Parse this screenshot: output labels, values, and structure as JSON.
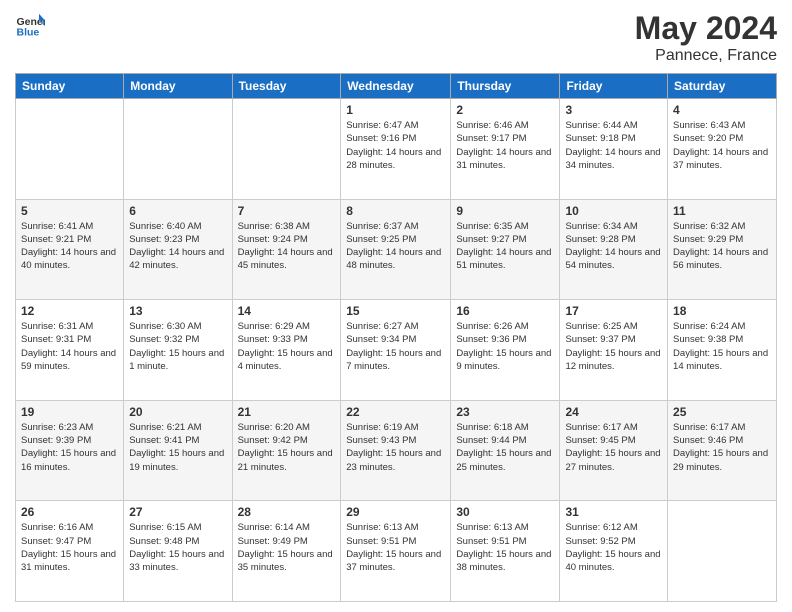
{
  "header": {
    "logo_general": "General",
    "logo_blue": "Blue",
    "month_title": "May 2024",
    "location": "Pannece, France"
  },
  "days_of_week": [
    "Sunday",
    "Monday",
    "Tuesday",
    "Wednesday",
    "Thursday",
    "Friday",
    "Saturday"
  ],
  "weeks": [
    [
      {
        "num": "",
        "info": ""
      },
      {
        "num": "",
        "info": ""
      },
      {
        "num": "",
        "info": ""
      },
      {
        "num": "1",
        "info": "Sunrise: 6:47 AM\nSunset: 9:16 PM\nDaylight: 14 hours and 28 minutes."
      },
      {
        "num": "2",
        "info": "Sunrise: 6:46 AM\nSunset: 9:17 PM\nDaylight: 14 hours and 31 minutes."
      },
      {
        "num": "3",
        "info": "Sunrise: 6:44 AM\nSunset: 9:18 PM\nDaylight: 14 hours and 34 minutes."
      },
      {
        "num": "4",
        "info": "Sunrise: 6:43 AM\nSunset: 9:20 PM\nDaylight: 14 hours and 37 minutes."
      }
    ],
    [
      {
        "num": "5",
        "info": "Sunrise: 6:41 AM\nSunset: 9:21 PM\nDaylight: 14 hours and 40 minutes."
      },
      {
        "num": "6",
        "info": "Sunrise: 6:40 AM\nSunset: 9:23 PM\nDaylight: 14 hours and 42 minutes."
      },
      {
        "num": "7",
        "info": "Sunrise: 6:38 AM\nSunset: 9:24 PM\nDaylight: 14 hours and 45 minutes."
      },
      {
        "num": "8",
        "info": "Sunrise: 6:37 AM\nSunset: 9:25 PM\nDaylight: 14 hours and 48 minutes."
      },
      {
        "num": "9",
        "info": "Sunrise: 6:35 AM\nSunset: 9:27 PM\nDaylight: 14 hours and 51 minutes."
      },
      {
        "num": "10",
        "info": "Sunrise: 6:34 AM\nSunset: 9:28 PM\nDaylight: 14 hours and 54 minutes."
      },
      {
        "num": "11",
        "info": "Sunrise: 6:32 AM\nSunset: 9:29 PM\nDaylight: 14 hours and 56 minutes."
      }
    ],
    [
      {
        "num": "12",
        "info": "Sunrise: 6:31 AM\nSunset: 9:31 PM\nDaylight: 14 hours and 59 minutes."
      },
      {
        "num": "13",
        "info": "Sunrise: 6:30 AM\nSunset: 9:32 PM\nDaylight: 15 hours and 1 minute."
      },
      {
        "num": "14",
        "info": "Sunrise: 6:29 AM\nSunset: 9:33 PM\nDaylight: 15 hours and 4 minutes."
      },
      {
        "num": "15",
        "info": "Sunrise: 6:27 AM\nSunset: 9:34 PM\nDaylight: 15 hours and 7 minutes."
      },
      {
        "num": "16",
        "info": "Sunrise: 6:26 AM\nSunset: 9:36 PM\nDaylight: 15 hours and 9 minutes."
      },
      {
        "num": "17",
        "info": "Sunrise: 6:25 AM\nSunset: 9:37 PM\nDaylight: 15 hours and 12 minutes."
      },
      {
        "num": "18",
        "info": "Sunrise: 6:24 AM\nSunset: 9:38 PM\nDaylight: 15 hours and 14 minutes."
      }
    ],
    [
      {
        "num": "19",
        "info": "Sunrise: 6:23 AM\nSunset: 9:39 PM\nDaylight: 15 hours and 16 minutes."
      },
      {
        "num": "20",
        "info": "Sunrise: 6:21 AM\nSunset: 9:41 PM\nDaylight: 15 hours and 19 minutes."
      },
      {
        "num": "21",
        "info": "Sunrise: 6:20 AM\nSunset: 9:42 PM\nDaylight: 15 hours and 21 minutes."
      },
      {
        "num": "22",
        "info": "Sunrise: 6:19 AM\nSunset: 9:43 PM\nDaylight: 15 hours and 23 minutes."
      },
      {
        "num": "23",
        "info": "Sunrise: 6:18 AM\nSunset: 9:44 PM\nDaylight: 15 hours and 25 minutes."
      },
      {
        "num": "24",
        "info": "Sunrise: 6:17 AM\nSunset: 9:45 PM\nDaylight: 15 hours and 27 minutes."
      },
      {
        "num": "25",
        "info": "Sunrise: 6:17 AM\nSunset: 9:46 PM\nDaylight: 15 hours and 29 minutes."
      }
    ],
    [
      {
        "num": "26",
        "info": "Sunrise: 6:16 AM\nSunset: 9:47 PM\nDaylight: 15 hours and 31 minutes."
      },
      {
        "num": "27",
        "info": "Sunrise: 6:15 AM\nSunset: 9:48 PM\nDaylight: 15 hours and 33 minutes."
      },
      {
        "num": "28",
        "info": "Sunrise: 6:14 AM\nSunset: 9:49 PM\nDaylight: 15 hours and 35 minutes."
      },
      {
        "num": "29",
        "info": "Sunrise: 6:13 AM\nSunset: 9:51 PM\nDaylight: 15 hours and 37 minutes."
      },
      {
        "num": "30",
        "info": "Sunrise: 6:13 AM\nSunset: 9:51 PM\nDaylight: 15 hours and 38 minutes."
      },
      {
        "num": "31",
        "info": "Sunrise: 6:12 AM\nSunset: 9:52 PM\nDaylight: 15 hours and 40 minutes."
      },
      {
        "num": "",
        "info": ""
      }
    ]
  ]
}
